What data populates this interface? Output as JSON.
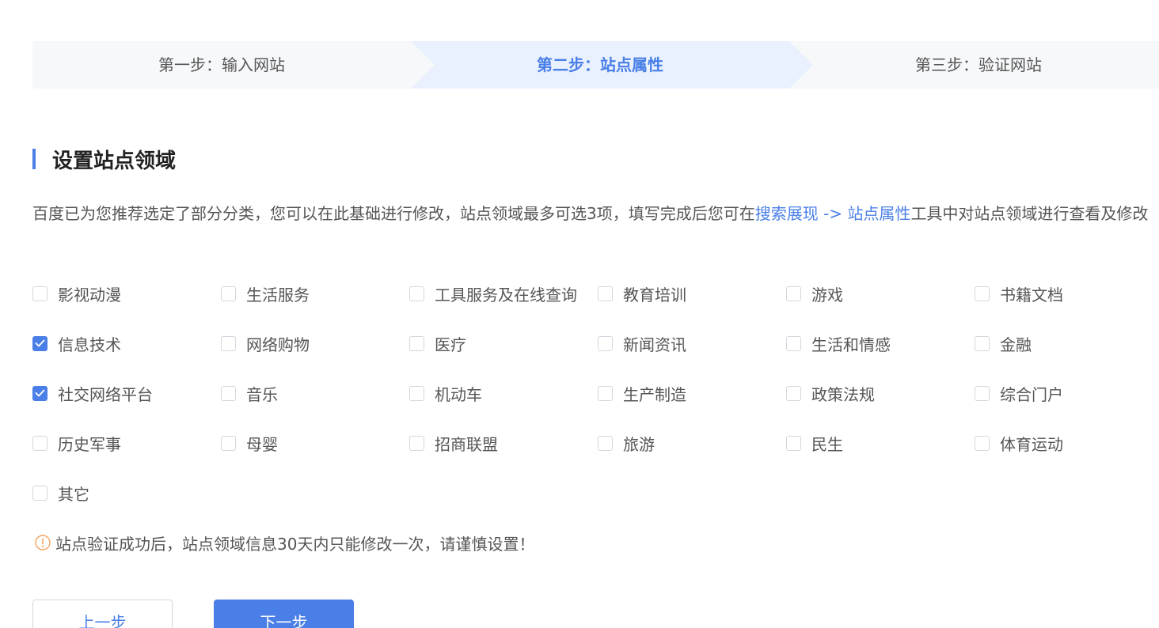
{
  "steps": [
    {
      "label": "第一步：输入网站",
      "active": false
    },
    {
      "label": "第二步：站点属性",
      "active": true
    },
    {
      "label": "第三步：验证网站",
      "active": false
    }
  ],
  "section": {
    "title": "设置站点领域"
  },
  "description": {
    "text_before": "百度已为您推荐选定了部分分类，您可以在此基础进行修改，站点领域最多可选3项，填写完成后您可在",
    "link_search": "搜索展现",
    "arrow": " -> ",
    "link_site_attr": "站点属性",
    "text_after": "工具中对站点领域进行查看及修改"
  },
  "categories": [
    {
      "label": "影视动漫",
      "checked": false
    },
    {
      "label": "生活服务",
      "checked": false
    },
    {
      "label": "工具服务及在线查询",
      "checked": false
    },
    {
      "label": "教育培训",
      "checked": false
    },
    {
      "label": "游戏",
      "checked": false
    },
    {
      "label": "书籍文档",
      "checked": false
    },
    {
      "label": "信息技术",
      "checked": true
    },
    {
      "label": "网络购物",
      "checked": false
    },
    {
      "label": "医疗",
      "checked": false
    },
    {
      "label": "新闻资讯",
      "checked": false
    },
    {
      "label": "生活和情感",
      "checked": false
    },
    {
      "label": "金融",
      "checked": false
    },
    {
      "label": "社交网络平台",
      "checked": true
    },
    {
      "label": "音乐",
      "checked": false
    },
    {
      "label": "机动车",
      "checked": false
    },
    {
      "label": "生产制造",
      "checked": false
    },
    {
      "label": "政策法规",
      "checked": false
    },
    {
      "label": "综合门户",
      "checked": false
    },
    {
      "label": "历史军事",
      "checked": false
    },
    {
      "label": "母婴",
      "checked": false
    },
    {
      "label": "招商联盟",
      "checked": false
    },
    {
      "label": "旅游",
      "checked": false
    },
    {
      "label": "民生",
      "checked": false
    },
    {
      "label": "体育运动",
      "checked": false
    },
    {
      "label": "其它",
      "checked": false
    }
  ],
  "warning": {
    "icon": "exclamation-circle-icon",
    "text": "站点验证成功后，站点领域信息30天内只能修改一次，请谨慎设置！"
  },
  "buttons": {
    "prev_label": "上一步",
    "next_label": "下一步"
  },
  "colors": {
    "accent": "#4a7fe8",
    "active_step_bg": "#e9f1fe",
    "step_bg": "#f7f8fa",
    "warning": "#f5a25d"
  }
}
